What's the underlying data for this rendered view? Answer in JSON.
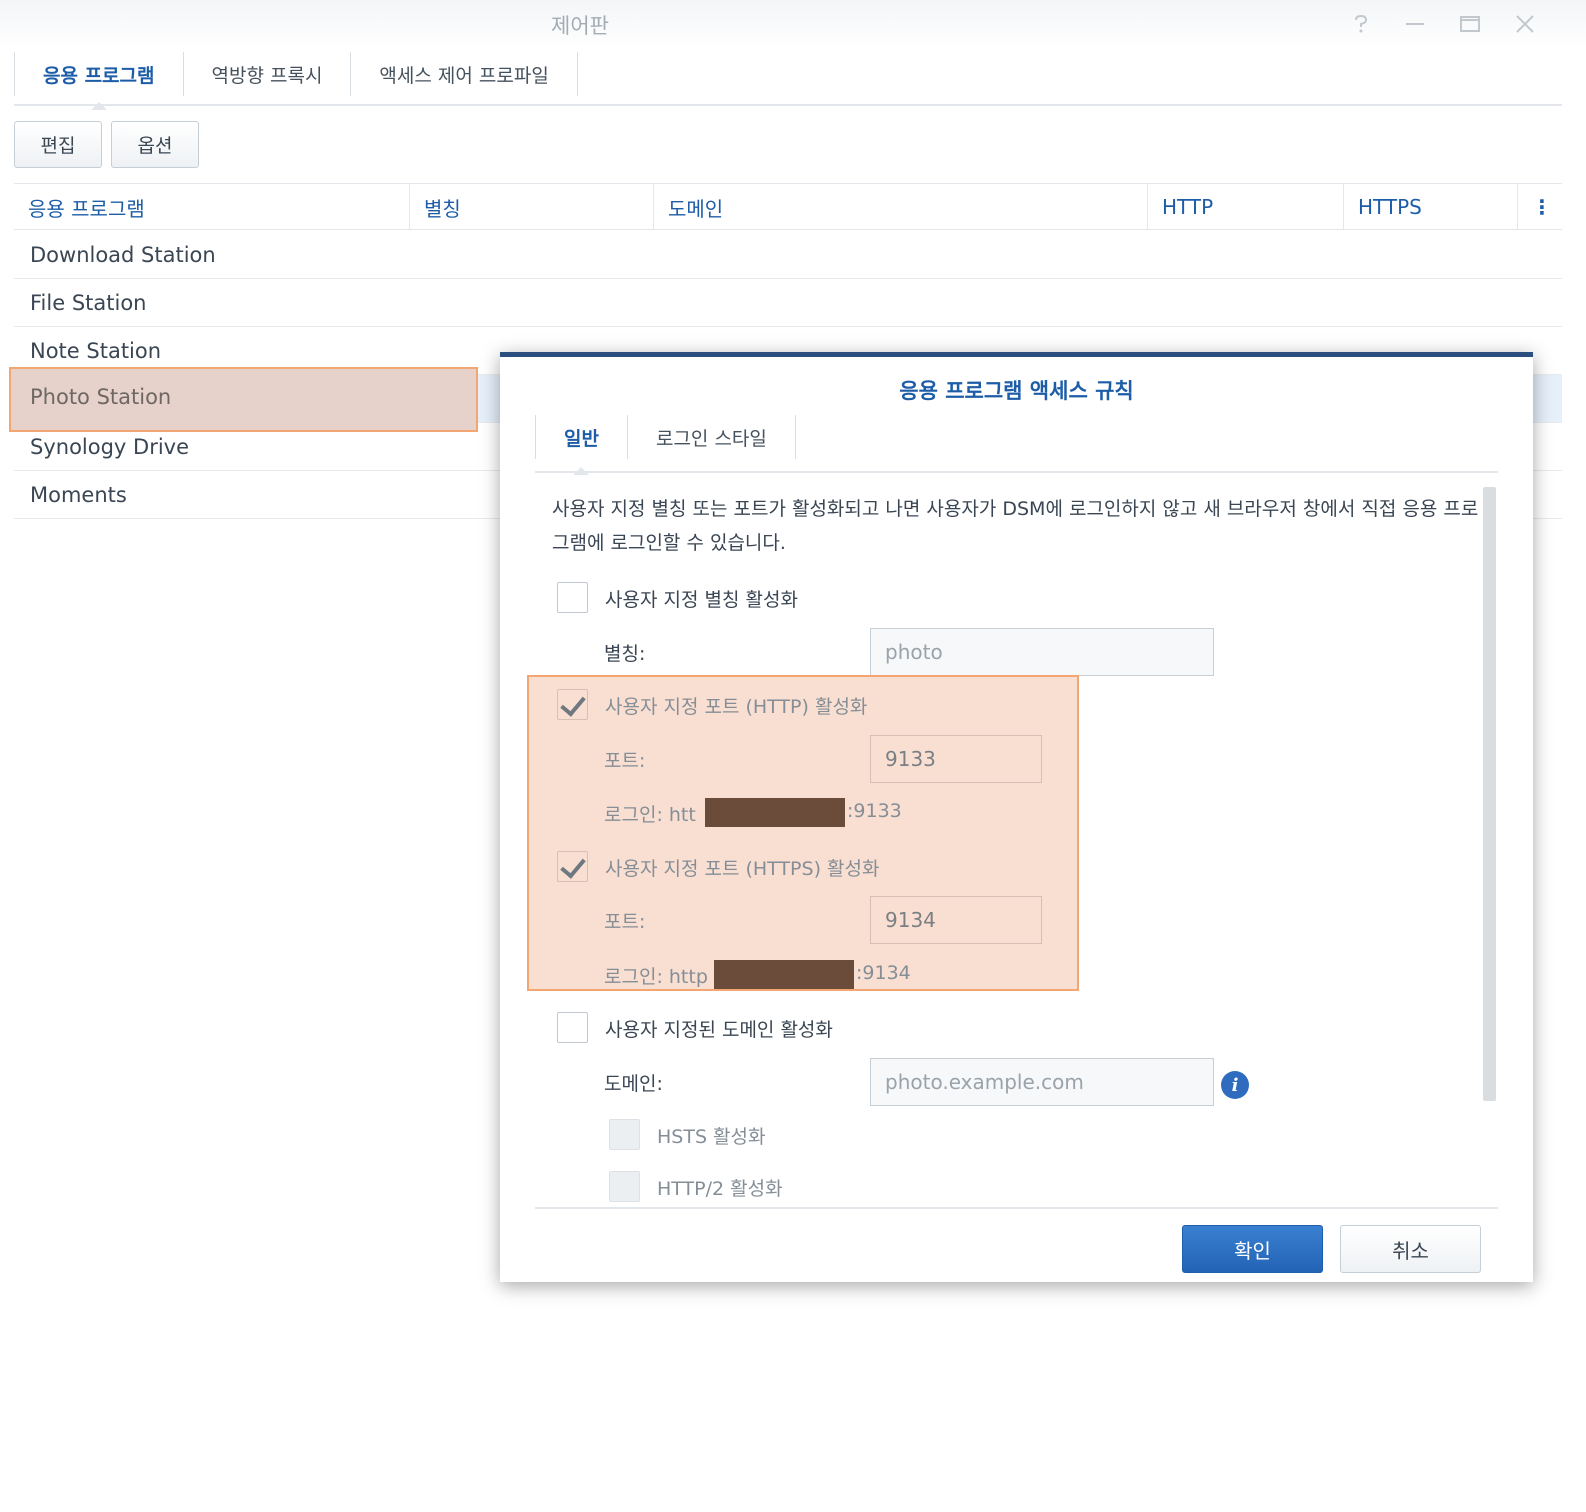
{
  "window": {
    "title": "제어판",
    "help_icon": "question-icon",
    "minimize_icon": "minimize-icon",
    "maximize_icon": "maximize-icon",
    "close_icon": "close-icon"
  },
  "tabs": [
    {
      "label": "응용 프로그램",
      "active": true
    },
    {
      "label": "역방향 프록시",
      "active": false
    },
    {
      "label": "액세스 제어 프로파일",
      "active": false
    }
  ],
  "toolbar": {
    "edit_label": "편집",
    "options_label": "옵션"
  },
  "table": {
    "columns": [
      "응용 프로그램",
      "별칭",
      "도메인",
      "HTTP",
      "HTTPS"
    ],
    "more_icon": "⋮",
    "rows": [
      "Download Station",
      "File Station",
      "Note Station",
      "Photo Station",
      "Synology Drive",
      "Moments"
    ],
    "selected_row": "Photo Station"
  },
  "dialog": {
    "title": "응용 프로그램 액세스 규칙",
    "tabs": [
      {
        "label": "일반",
        "active": true
      },
      {
        "label": "로그인 스타일",
        "active": false
      }
    ],
    "description": "사용자 지정 별칭 또는 포트가 활성화되고 나면 사용자가 DSM에 로그인하지 않고 새 브라우저 창에서 직접 응용 프로그램에 로그인할 수 있습니다.",
    "alias": {
      "checkbox_label": "사용자 지정 별칭 활성화",
      "checked": false,
      "field_label": "별칭:",
      "placeholder": "photo"
    },
    "http": {
      "checkbox_label": "사용자 지정 포트 (HTTP) 활성화",
      "checked": true,
      "port_label": "포트:",
      "port_value": "9133",
      "login_prefix": "로그인: htt",
      "login_suffix": ":9133"
    },
    "https": {
      "checkbox_label": "사용자 지정 포트 (HTTPS) 활성화",
      "checked": true,
      "port_label": "포트:",
      "port_value": "9134",
      "login_prefix": "로그인: http",
      "login_suffix": ":9134"
    },
    "domain": {
      "checkbox_label": "사용자 지정된 도메인 활성화",
      "checked": false,
      "field_label": "도메인:",
      "placeholder": "photo.example.com",
      "info_icon": "i"
    },
    "hsts": {
      "label": "HSTS 활성화",
      "checked": false
    },
    "http2": {
      "label": "HTTP/2 활성화",
      "checked": false
    },
    "ok_label": "확인",
    "cancel_label": "취소"
  },
  "colors": {
    "accent": "#1d5da8",
    "highlight_fill": "#f9dfd2",
    "highlight_border": "#f3a572",
    "redaction": "#6b4b3a"
  }
}
